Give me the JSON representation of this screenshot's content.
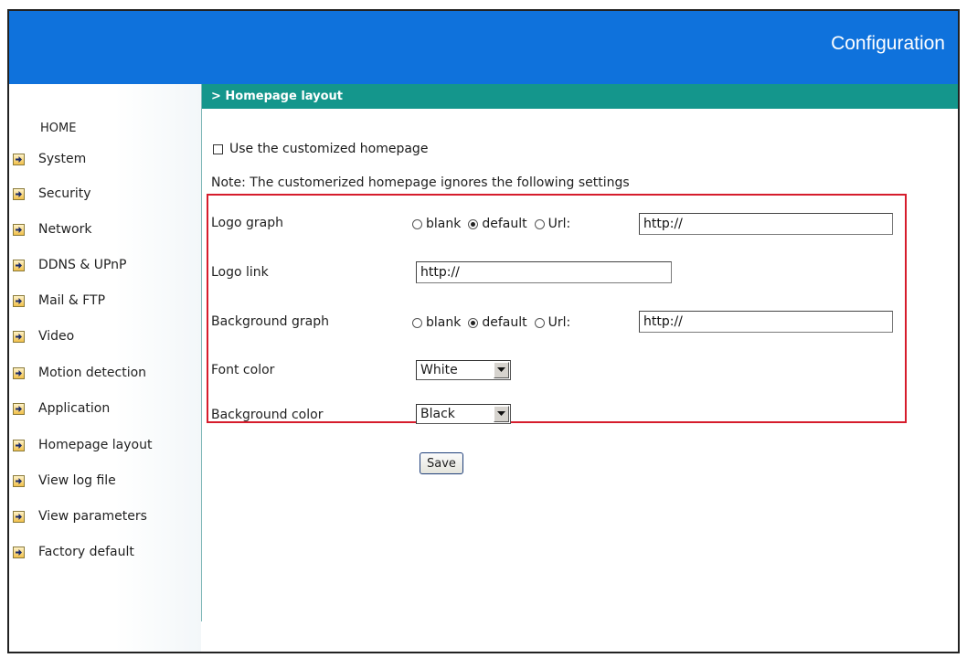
{
  "header": {
    "title": "Configuration"
  },
  "sidebar": {
    "home_label": "HOME",
    "items": [
      {
        "label": "System"
      },
      {
        "label": "Security"
      },
      {
        "label": "Network"
      },
      {
        "label": "DDNS & UPnP"
      },
      {
        "label": "Mail & FTP"
      },
      {
        "label": "Video"
      },
      {
        "label": "Motion detection"
      },
      {
        "label": "Application"
      },
      {
        "label": "Homepage layout"
      },
      {
        "label": "View log file"
      },
      {
        "label": "View parameters"
      },
      {
        "label": "Factory default"
      }
    ],
    "item_icon": "arrow-right-icon"
  },
  "section": {
    "title": "> Homepage layout"
  },
  "form": {
    "use_custom_label": "Use the customized homepage",
    "use_custom_checked": false,
    "note": "Note: The customerized homepage ignores the following settings",
    "logo_graph": {
      "label": "Logo graph",
      "options": {
        "blank": "blank",
        "default": "default",
        "url": "Url:"
      },
      "selected": "default",
      "url_value": "http://"
    },
    "logo_link": {
      "label": "Logo link",
      "value": "http://"
    },
    "background_graph": {
      "label": "Background graph",
      "options": {
        "blank": "blank",
        "default": "default",
        "url": "Url:"
      },
      "selected": "default",
      "url_value": "http://"
    },
    "font_color": {
      "label": "Font color",
      "value": "White"
    },
    "background_color": {
      "label": "Background color",
      "value": "Black"
    },
    "save_label": "Save"
  },
  "colors": {
    "header_blue": "#0f72dc",
    "section_teal": "#14968c",
    "highlight_red": "#d61c2c"
  }
}
